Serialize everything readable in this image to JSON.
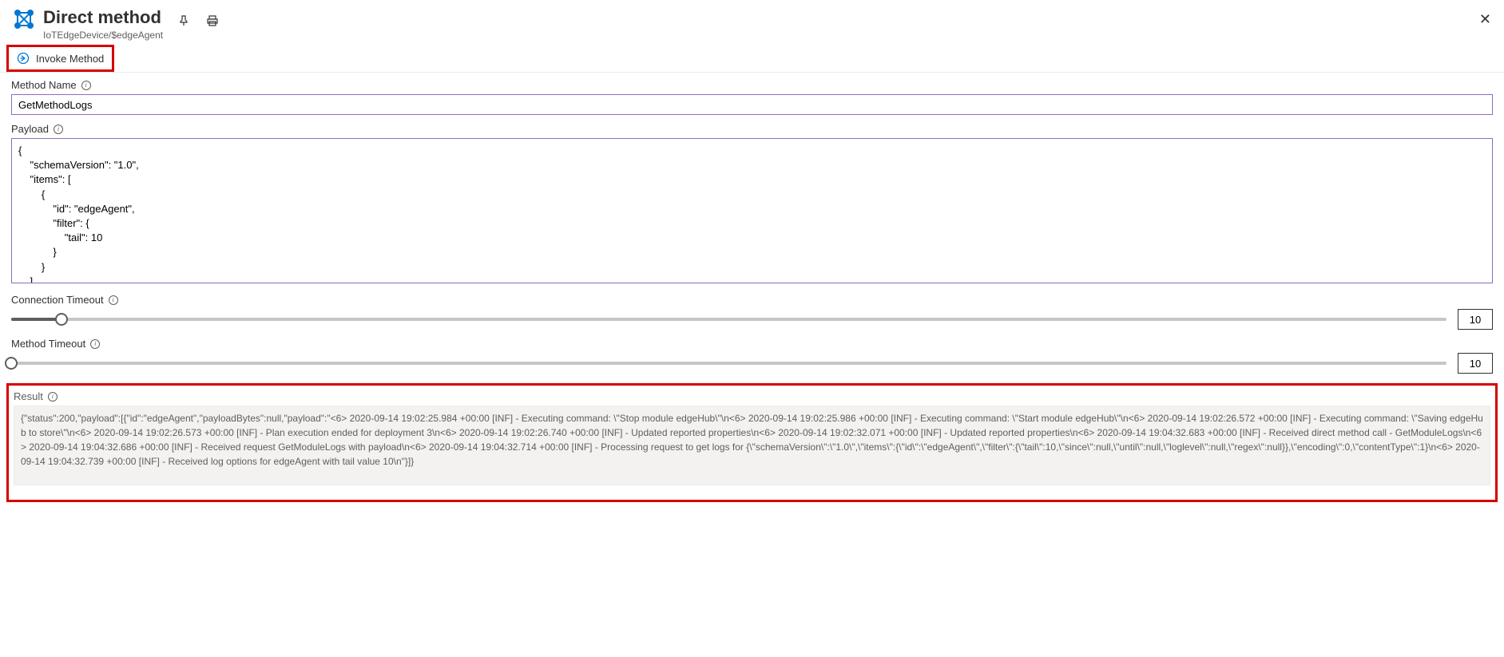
{
  "header": {
    "title": "Direct method",
    "subtitle": "IoTEdgeDevice/$edgeAgent"
  },
  "toolbar": {
    "invoke_label": "Invoke Method"
  },
  "methodName": {
    "label": "Method Name",
    "value": "GetMethodLogs"
  },
  "payload": {
    "label": "Payload",
    "value": "{\n    \"schemaVersion\": \"1.0\",\n    \"items\": [\n        {\n            \"id\": \"edgeAgent\",\n            \"filter\": {\n                \"tail\": 10\n            }\n        }\n    ],"
  },
  "connectionTimeout": {
    "label": "Connection Timeout",
    "value": "10",
    "percent": 3.5
  },
  "methodTimeout": {
    "label": "Method Timeout",
    "value": "10",
    "percent": 0
  },
  "result": {
    "label": "Result",
    "text": "{\"status\":200,\"payload\":[{\"id\":\"edgeAgent\",\"payloadBytes\":null,\"payload\":\"<6> 2020-09-14 19:02:25.984 +00:00 [INF] - Executing command: \\\"Stop module edgeHub\\\"\\n<6> 2020-09-14 19:02:25.986 +00:00 [INF] - Executing command: \\\"Start module edgeHub\\\"\\n<6> 2020-09-14 19:02:26.572 +00:00 [INF] - Executing command: \\\"Saving edgeHub to store\\\"\\n<6> 2020-09-14 19:02:26.573 +00:00 [INF] - Plan execution ended for deployment 3\\n<6> 2020-09-14 19:02:26.740 +00:00 [INF] - Updated reported properties\\n<6> 2020-09-14 19:02:32.071 +00:00 [INF] - Updated reported properties\\n<6> 2020-09-14 19:04:32.683 +00:00 [INF] - Received direct method call - GetModuleLogs\\n<6> 2020-09-14 19:04:32.686 +00:00 [INF] - Received request GetModuleLogs with payload\\n<6> 2020-09-14 19:04:32.714 +00:00 [INF] - Processing request to get logs for {\\\"schemaVersion\\\":\\\"1.0\\\",\\\"items\\\":{\\\"id\\\":\\\"edgeAgent\\\",\\\"filter\\\":{\\\"tail\\\":10,\\\"since\\\":null,\\\"until\\\":null,\\\"loglevel\\\":null,\\\"regex\\\":null}},\\\"encoding\\\":0,\\\"contentType\\\":1}\\n<6> 2020-09-14 19:04:32.739 +00:00 [INF] - Received log options for edgeAgent with tail value 10\\n\"}]}"
  }
}
